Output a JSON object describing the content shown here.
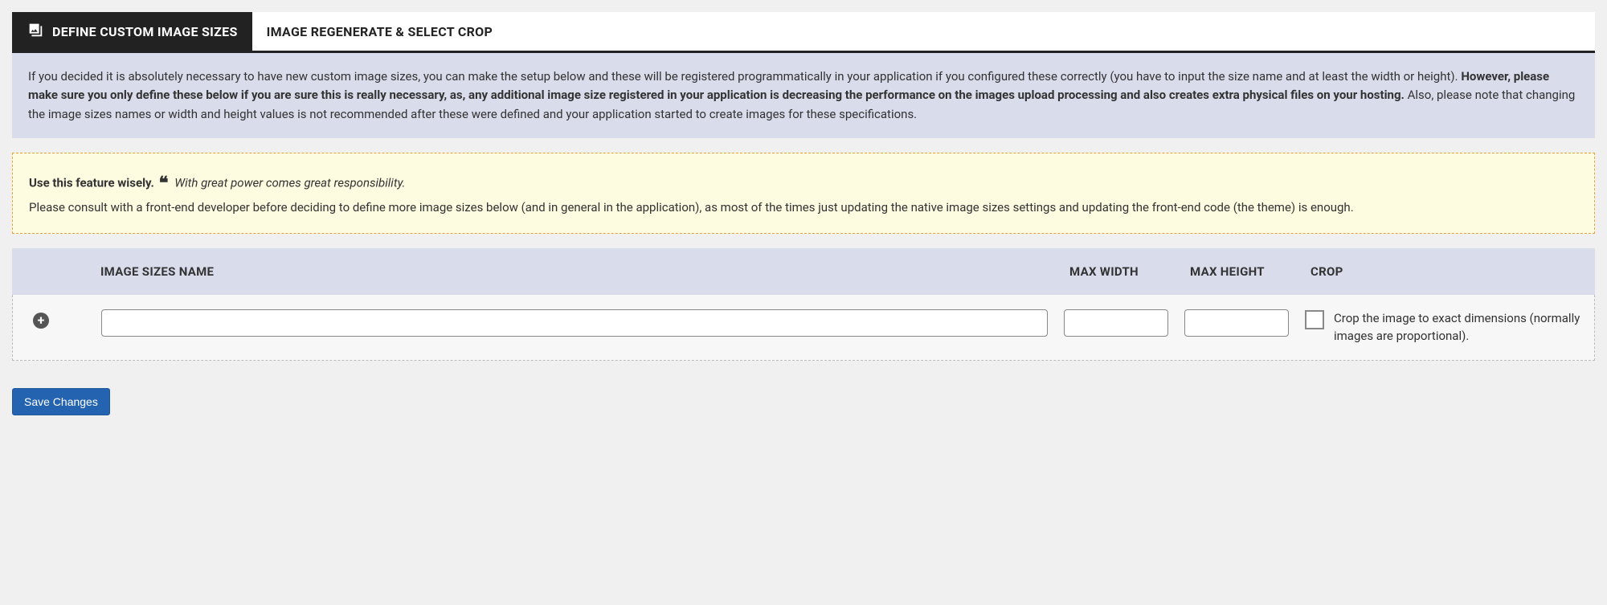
{
  "tabs": {
    "active_label": "DEFINE CUSTOM IMAGE SIZES",
    "inactive_label": "IMAGE REGENERATE & SELECT CROP"
  },
  "info": {
    "pre": "If you decided it is absolutely necessary to have new custom image sizes, you can make the setup below and these will be registered programmatically in your application if you configured these correctly (you have to input the size name and at least the width or height). ",
    "bold": "However, please make sure you only define these below if you are sure this is really necessary, as, any additional image size registered in your application is decreasing the performance on the images upload processing and also creates extra physical files on your hosting.",
    "post": " Also, please note that changing the image sizes names or width and height values is not recommended after these were defined and your application started to create images for these specifications."
  },
  "warn": {
    "strong": "Use this feature wisely.",
    "quote_glyph": "❝",
    "quote": "With great power comes great responsibility.",
    "body": "Please consult with a front-end developer before deciding to define more image sizes below (and in general in the application), as most of the times just updating the native image sizes settings and updating the front-end code (the theme) is enough."
  },
  "table": {
    "headers": {
      "name": "IMAGE SIZES NAME",
      "width": "MAX WIDTH",
      "height": "MAX HEIGHT",
      "crop": "CROP"
    },
    "row": {
      "name_value": "",
      "width_value": "",
      "height_value": "",
      "crop_checked": false,
      "crop_label": "Crop the image to exact dimensions (normally images are proportional)."
    }
  },
  "actions": {
    "save": "Save Changes"
  }
}
